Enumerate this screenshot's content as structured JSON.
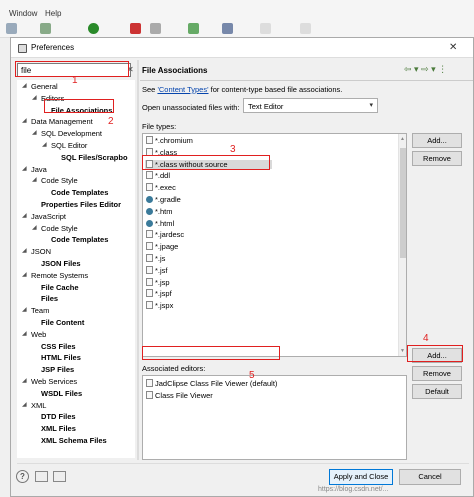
{
  "menubar": {
    "window": "Window",
    "help": "Help"
  },
  "dialog": {
    "title": "Preferences",
    "filter_value": "file",
    "filter_clear": "✕",
    "tree": [
      {
        "label": "General",
        "bold": false,
        "indent": 0,
        "arrow": "◢"
      },
      {
        "label": "Editors",
        "bold": false,
        "indent": 1,
        "arrow": "◢"
      },
      {
        "label": "File Associations",
        "bold": true,
        "indent": 2,
        "arrow": "",
        "selected": true
      },
      {
        "label": "Data Management",
        "bold": false,
        "indent": 0,
        "arrow": "◢"
      },
      {
        "label": "SQL Development",
        "bold": false,
        "indent": 1,
        "arrow": "◢"
      },
      {
        "label": "SQL Editor",
        "bold": false,
        "indent": 2,
        "arrow": "◢"
      },
      {
        "label": "SQL Files/Scrapbo",
        "bold": true,
        "indent": 3,
        "arrow": ""
      },
      {
        "label": "Java",
        "bold": false,
        "indent": 0,
        "arrow": "◢"
      },
      {
        "label": "Code Style",
        "bold": false,
        "indent": 1,
        "arrow": "◢"
      },
      {
        "label": "Code Templates",
        "bold": true,
        "indent": 2,
        "arrow": ""
      },
      {
        "label": "Properties Files Editor",
        "bold": true,
        "indent": 1,
        "arrow": ""
      },
      {
        "label": "JavaScript",
        "bold": false,
        "indent": 0,
        "arrow": "◢"
      },
      {
        "label": "Code Style",
        "bold": false,
        "indent": 1,
        "arrow": "◢"
      },
      {
        "label": "Code Templates",
        "bold": true,
        "indent": 2,
        "arrow": ""
      },
      {
        "label": "JSON",
        "bold": false,
        "indent": 0,
        "arrow": "◢"
      },
      {
        "label": "JSON Files",
        "bold": true,
        "indent": 1,
        "arrow": ""
      },
      {
        "label": "Remote Systems",
        "bold": false,
        "indent": 0,
        "arrow": "◢"
      },
      {
        "label": "File Cache",
        "bold": true,
        "indent": 1,
        "arrow": ""
      },
      {
        "label": "Files",
        "bold": true,
        "indent": 1,
        "arrow": ""
      },
      {
        "label": "Team",
        "bold": false,
        "indent": 0,
        "arrow": "◢"
      },
      {
        "label": "File Content",
        "bold": true,
        "indent": 1,
        "arrow": ""
      },
      {
        "label": "Web",
        "bold": false,
        "indent": 0,
        "arrow": "◢"
      },
      {
        "label": "CSS Files",
        "bold": true,
        "indent": 1,
        "arrow": ""
      },
      {
        "label": "HTML Files",
        "bold": true,
        "indent": 1,
        "arrow": ""
      },
      {
        "label": "JSP Files",
        "bold": true,
        "indent": 1,
        "arrow": ""
      },
      {
        "label": "Web Services",
        "bold": false,
        "indent": 0,
        "arrow": "◢"
      },
      {
        "label": "WSDL Files",
        "bold": true,
        "indent": 1,
        "arrow": ""
      },
      {
        "label": "XML",
        "bold": false,
        "indent": 0,
        "arrow": "◢"
      },
      {
        "label": "DTD Files",
        "bold": true,
        "indent": 1,
        "arrow": ""
      },
      {
        "label": "XML Files",
        "bold": true,
        "indent": 1,
        "arrow": ""
      },
      {
        "label": "XML Schema Files",
        "bold": true,
        "indent": 1,
        "arrow": ""
      }
    ],
    "pane_title": "File Associations",
    "desc_prefix": "See ",
    "desc_link": "'Content Types'",
    "desc_suffix": " for content-type based file associations.",
    "open_label": "Open unassociated files with:",
    "open_value": "Text Editor",
    "file_types_label": "File types:",
    "file_types": [
      {
        "label": "*.chromium",
        "icon": "file"
      },
      {
        "label": "*.class",
        "icon": "file"
      },
      {
        "label": "*.class without source",
        "icon": "file",
        "selected": true
      },
      {
        "label": "*.ddl",
        "icon": "file"
      },
      {
        "label": "*.exec",
        "icon": "file"
      },
      {
        "label": "*.gradle",
        "icon": "globe"
      },
      {
        "label": "*.htm",
        "icon": "globe"
      },
      {
        "label": "*.html",
        "icon": "globe"
      },
      {
        "label": "*.jardesc",
        "icon": "file"
      },
      {
        "label": "*.jpage",
        "icon": "file"
      },
      {
        "label": "*.js",
        "icon": "file"
      },
      {
        "label": "*.jsf",
        "icon": "file"
      },
      {
        "label": "*.jsp",
        "icon": "file"
      },
      {
        "label": "*.jspf",
        "icon": "file"
      },
      {
        "label": "*.jspx",
        "icon": "file"
      }
    ],
    "ft_add": "Add...",
    "ft_remove": "Remove",
    "assoc_label": "Associated editors:",
    "assoc_editors": [
      {
        "label": "JadClipse Class File Viewer (default)",
        "selected": true
      },
      {
        "label": "Class File Viewer",
        "selected": false
      }
    ],
    "ae_add": "Add...",
    "ae_remove": "Remove",
    "ae_default": "Default",
    "apply_close": "Apply and Close",
    "cancel": "Cancel"
  },
  "annotations": [
    "1",
    "2",
    "3",
    "4",
    "5"
  ],
  "watermark": "https://blog.csdn.net/..."
}
